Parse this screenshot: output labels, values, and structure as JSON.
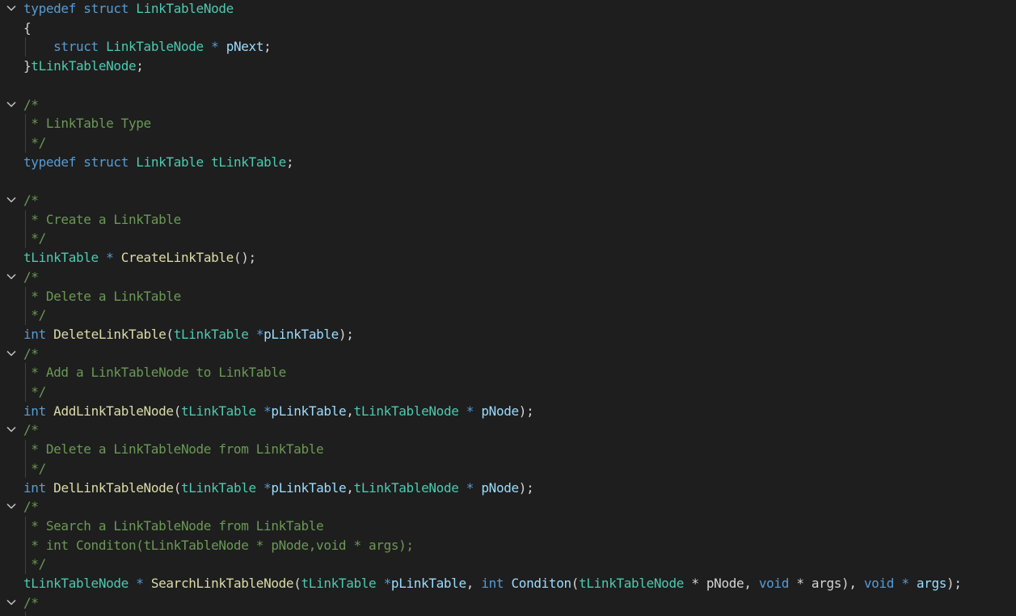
{
  "colors": {
    "background": "#1e1e1e",
    "keyword": "#569cd6",
    "type": "#4ec9b0",
    "function": "#dcdcaa",
    "variable": "#9cdcfe",
    "plain": "#d4d4d4",
    "comment": "#6a9955",
    "fold_icon": "#c5c5c5",
    "indent_guide": "#404040"
  },
  "lines": [
    {
      "fold": true,
      "guide": false,
      "tokens": [
        {
          "t": "typedef",
          "c": "kw"
        },
        {
          "t": " ",
          "c": "pl"
        },
        {
          "t": "struct",
          "c": "kw"
        },
        {
          "t": " ",
          "c": "pl"
        },
        {
          "t": "LinkTableNode",
          "c": "type"
        }
      ]
    },
    {
      "fold": false,
      "guide": false,
      "tokens": [
        {
          "t": "{",
          "c": "pl"
        }
      ]
    },
    {
      "fold": false,
      "guide": true,
      "tokens": [
        {
          "t": "    ",
          "c": "pl"
        },
        {
          "t": "struct",
          "c": "kw"
        },
        {
          "t": " ",
          "c": "pl"
        },
        {
          "t": "LinkTableNode",
          "c": "type"
        },
        {
          "t": " * ",
          "c": "kw"
        },
        {
          "t": "pNext",
          "c": "var"
        },
        {
          "t": ";",
          "c": "pl"
        }
      ]
    },
    {
      "fold": false,
      "guide": false,
      "tokens": [
        {
          "t": "}",
          "c": "pl"
        },
        {
          "t": "tLinkTableNode",
          "c": "type"
        },
        {
          "t": ";",
          "c": "pl"
        }
      ]
    },
    {
      "fold": false,
      "guide": false,
      "tokens": []
    },
    {
      "fold": true,
      "guide": false,
      "tokens": [
        {
          "t": "/*",
          "c": "cm"
        }
      ]
    },
    {
      "fold": false,
      "guide": true,
      "tokens": [
        {
          "t": " * LinkTable Type",
          "c": "cm"
        }
      ]
    },
    {
      "fold": false,
      "guide": true,
      "tokens": [
        {
          "t": " */",
          "c": "cm"
        }
      ]
    },
    {
      "fold": false,
      "guide": false,
      "tokens": [
        {
          "t": "typedef",
          "c": "kw"
        },
        {
          "t": " ",
          "c": "pl"
        },
        {
          "t": "struct",
          "c": "kw"
        },
        {
          "t": " ",
          "c": "pl"
        },
        {
          "t": "LinkTable",
          "c": "type"
        },
        {
          "t": " ",
          "c": "pl"
        },
        {
          "t": "tLinkTable",
          "c": "type"
        },
        {
          "t": ";",
          "c": "pl"
        }
      ]
    },
    {
      "fold": false,
      "guide": false,
      "tokens": []
    },
    {
      "fold": true,
      "guide": false,
      "tokens": [
        {
          "t": "/*",
          "c": "cm"
        }
      ]
    },
    {
      "fold": false,
      "guide": true,
      "tokens": [
        {
          "t": " * Create a LinkTable",
          "c": "cm"
        }
      ]
    },
    {
      "fold": false,
      "guide": true,
      "tokens": [
        {
          "t": " */",
          "c": "cm"
        }
      ]
    },
    {
      "fold": false,
      "guide": false,
      "tokens": [
        {
          "t": "tLinkTable",
          "c": "type"
        },
        {
          "t": " * ",
          "c": "kw"
        },
        {
          "t": "CreateLinkTable",
          "c": "fn"
        },
        {
          "t": "();",
          "c": "pl"
        }
      ]
    },
    {
      "fold": true,
      "guide": false,
      "tokens": [
        {
          "t": "/*",
          "c": "cm"
        }
      ]
    },
    {
      "fold": false,
      "guide": true,
      "tokens": [
        {
          "t": " * Delete a LinkTable",
          "c": "cm"
        }
      ]
    },
    {
      "fold": false,
      "guide": true,
      "tokens": [
        {
          "t": " */",
          "c": "cm"
        }
      ]
    },
    {
      "fold": false,
      "guide": false,
      "tokens": [
        {
          "t": "int",
          "c": "kw"
        },
        {
          "t": " ",
          "c": "pl"
        },
        {
          "t": "DeleteLinkTable",
          "c": "fn"
        },
        {
          "t": "(",
          "c": "pl"
        },
        {
          "t": "tLinkTable",
          "c": "type"
        },
        {
          "t": " *",
          "c": "kw"
        },
        {
          "t": "pLinkTable",
          "c": "var"
        },
        {
          "t": ");",
          "c": "pl"
        }
      ]
    },
    {
      "fold": true,
      "guide": false,
      "tokens": [
        {
          "t": "/*",
          "c": "cm"
        }
      ]
    },
    {
      "fold": false,
      "guide": true,
      "tokens": [
        {
          "t": " * Add a LinkTableNode to LinkTable",
          "c": "cm"
        }
      ]
    },
    {
      "fold": false,
      "guide": true,
      "tokens": [
        {
          "t": " */",
          "c": "cm"
        }
      ]
    },
    {
      "fold": false,
      "guide": false,
      "tokens": [
        {
          "t": "int",
          "c": "kw"
        },
        {
          "t": " ",
          "c": "pl"
        },
        {
          "t": "AddLinkTableNode",
          "c": "fn"
        },
        {
          "t": "(",
          "c": "pl"
        },
        {
          "t": "tLinkTable",
          "c": "type"
        },
        {
          "t": " *",
          "c": "kw"
        },
        {
          "t": "pLinkTable",
          "c": "var"
        },
        {
          "t": ",",
          "c": "pl"
        },
        {
          "t": "tLinkTableNode",
          "c": "type"
        },
        {
          "t": " * ",
          "c": "kw"
        },
        {
          "t": "pNode",
          "c": "var"
        },
        {
          "t": ");",
          "c": "pl"
        }
      ]
    },
    {
      "fold": true,
      "guide": false,
      "tokens": [
        {
          "t": "/*",
          "c": "cm"
        }
      ]
    },
    {
      "fold": false,
      "guide": true,
      "tokens": [
        {
          "t": " * Delete a LinkTableNode from LinkTable",
          "c": "cm"
        }
      ]
    },
    {
      "fold": false,
      "guide": true,
      "tokens": [
        {
          "t": " */",
          "c": "cm"
        }
      ]
    },
    {
      "fold": false,
      "guide": false,
      "tokens": [
        {
          "t": "int",
          "c": "kw"
        },
        {
          "t": " ",
          "c": "pl"
        },
        {
          "t": "DelLinkTableNode",
          "c": "fn"
        },
        {
          "t": "(",
          "c": "pl"
        },
        {
          "t": "tLinkTable",
          "c": "type"
        },
        {
          "t": " *",
          "c": "kw"
        },
        {
          "t": "pLinkTable",
          "c": "var"
        },
        {
          "t": ",",
          "c": "pl"
        },
        {
          "t": "tLinkTableNode",
          "c": "type"
        },
        {
          "t": " * ",
          "c": "kw"
        },
        {
          "t": "pNode",
          "c": "var"
        },
        {
          "t": ");",
          "c": "pl"
        }
      ]
    },
    {
      "fold": true,
      "guide": false,
      "tokens": [
        {
          "t": "/*",
          "c": "cm"
        }
      ]
    },
    {
      "fold": false,
      "guide": true,
      "tokens": [
        {
          "t": " * Search a LinkTableNode from LinkTable",
          "c": "cm"
        }
      ]
    },
    {
      "fold": false,
      "guide": true,
      "tokens": [
        {
          "t": " * int Conditon(tLinkTableNode * pNode,void * args);",
          "c": "cm"
        }
      ]
    },
    {
      "fold": false,
      "guide": true,
      "tokens": [
        {
          "t": " */",
          "c": "cm"
        }
      ]
    },
    {
      "fold": false,
      "guide": false,
      "tokens": [
        {
          "t": "tLinkTableNode",
          "c": "type"
        },
        {
          "t": " * ",
          "c": "kw"
        },
        {
          "t": "SearchLinkTableNode",
          "c": "fn"
        },
        {
          "t": "(",
          "c": "pl"
        },
        {
          "t": "tLinkTable",
          "c": "type"
        },
        {
          "t": " *",
          "c": "kw"
        },
        {
          "t": "pLinkTable",
          "c": "var"
        },
        {
          "t": ", ",
          "c": "pl"
        },
        {
          "t": "int",
          "c": "kw"
        },
        {
          "t": " ",
          "c": "pl"
        },
        {
          "t": "Conditon",
          "c": "var"
        },
        {
          "t": "(",
          "c": "pl"
        },
        {
          "t": "tLinkTableNode",
          "c": "type"
        },
        {
          "t": " * ",
          "c": "pl"
        },
        {
          "t": "pNode",
          "c": "pl"
        },
        {
          "t": ", ",
          "c": "pl"
        },
        {
          "t": "void",
          "c": "kw"
        },
        {
          "t": " * ",
          "c": "pl"
        },
        {
          "t": "args",
          "c": "pl"
        },
        {
          "t": "), ",
          "c": "pl"
        },
        {
          "t": "void",
          "c": "kw"
        },
        {
          "t": " * ",
          "c": "kw"
        },
        {
          "t": "args",
          "c": "var"
        },
        {
          "t": ");",
          "c": "pl"
        }
      ]
    },
    {
      "fold": true,
      "guide": false,
      "tokens": [
        {
          "t": "/*",
          "c": "cm"
        }
      ]
    },
    {
      "fold": false,
      "guide": true,
      "tokens": []
    }
  ]
}
